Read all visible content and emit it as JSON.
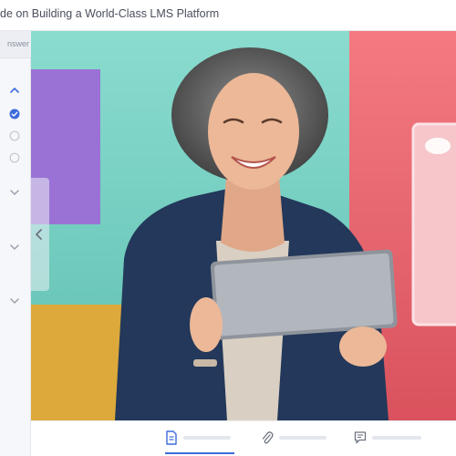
{
  "header": {
    "title": "de on Building a World-Class LMS Platform"
  },
  "sidebar": {
    "tab_label": "nswer",
    "items": [
      {
        "icon": "chevron-up-icon"
      },
      {
        "icon": "check-circle-icon",
        "state": "completed"
      },
      {
        "icon": "radio-empty-icon",
        "state": "pending"
      },
      {
        "icon": "radio-empty-icon",
        "state": "pending"
      },
      {
        "icon": "chevron-down-icon"
      },
      {
        "icon": "chevron-down-icon"
      },
      {
        "icon": "chevron-down-icon"
      }
    ]
  },
  "media": {
    "image": "Smiling woman with grey curly hair holding a tablet in front of teal, purple, yellow and pink color blocks",
    "nav_icon": "chevron-left-icon"
  },
  "toolbar": {
    "tabs": [
      {
        "icon": "document-icon",
        "active": true
      },
      {
        "icon": "paperclip-icon",
        "active": false
      },
      {
        "icon": "comment-icon",
        "active": false
      }
    ]
  },
  "colors": {
    "accent": "#3d6bdb",
    "teal": "#79d3c6",
    "pink": "#ef6b74",
    "purple": "#9a72d6",
    "yellow": "#dca93a",
    "shirt": "#23385a"
  }
}
